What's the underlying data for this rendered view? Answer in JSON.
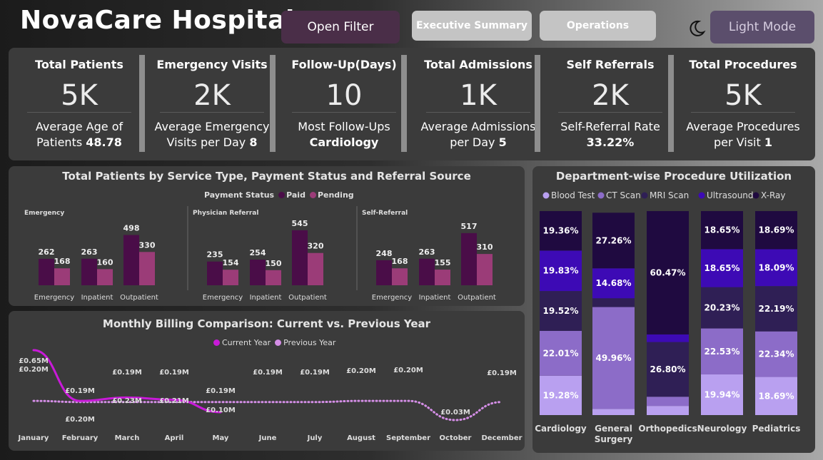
{
  "header": {
    "title": "NovaCare Hospitals",
    "open_filter": "Open Filter",
    "exec_summary": "Executive Summary",
    "operations": "Operations",
    "light_mode": "Light Mode",
    "moon_icon": "moon-icon"
  },
  "kpis": [
    {
      "title": "Total Patients",
      "value": "5K",
      "sub1": "Average Age of",
      "sub2": "Patients",
      "bold": "48.78"
    },
    {
      "title": "Emergency Visits",
      "value": "2K",
      "sub1": "Average Emergency",
      "sub2": "Visits per Day",
      "bold": "8"
    },
    {
      "title": "Follow-Up(Days)",
      "value": "10",
      "sub1": "Most Follow-Ups",
      "sub2": "",
      "bold": "Cardiology"
    },
    {
      "title": "Total Admissions",
      "value": "1K",
      "sub1": "Average Admissions",
      "sub2": "per Day",
      "bold": "5"
    },
    {
      "title": "Self Referrals",
      "value": "2K",
      "sub1": "Self-Referral Rate",
      "sub2": "",
      "bold": "33.22%"
    },
    {
      "title": "Total Procedures",
      "value": "5K",
      "sub1": "Average Procedures",
      "sub2": "per Visit",
      "bold": "1"
    }
  ],
  "colors": {
    "paid": "#4a0d48",
    "pending": "#9b3c78",
    "current_year": "#c81ad8",
    "previous_year": "#d48ee6",
    "blood_test": "#b9a0f0",
    "ct_scan": "#8c6cc8",
    "mri_scan": "#2f1f55",
    "ultrasound": "#3d0ab5",
    "xray": "#1f0a40"
  },
  "chart_data": [
    {
      "type": "bar",
      "title": "Total Patients by Service Type, Payment Status and Referral Source",
      "legend_title": "Payment Status",
      "series_names": [
        "Paid",
        "Pending"
      ],
      "panels": [
        {
          "name": "Emergency",
          "categories": [
            "Emergency",
            "Inpatient",
            "Outpatient"
          ],
          "paid": [
            262,
            263,
            498
          ],
          "pending": [
            168,
            160,
            330
          ]
        },
        {
          "name": "Physician Referral",
          "categories": [
            "Emergency",
            "Inpatient",
            "Outpatient"
          ],
          "paid": [
            235,
            254,
            545
          ],
          "pending": [
            154,
            150,
            320
          ]
        },
        {
          "name": "Self-Referral",
          "categories": [
            "Emergency",
            "Inpatient",
            "Outpatient"
          ],
          "paid": [
            248,
            263,
            517
          ],
          "pending": [
            168,
            155,
            310
          ]
        }
      ]
    },
    {
      "type": "line",
      "title": "Monthly Billing Comparison: Current vs. Previous Year",
      "x": [
        "January",
        "February",
        "March",
        "April",
        "May",
        "June",
        "July",
        "August",
        "September",
        "October",
        "December"
      ],
      "series": [
        {
          "name": "Current Year",
          "values": [
            0.65,
            0.2,
            0.23,
            0.21,
            0.1,
            null,
            null,
            null,
            null,
            null,
            null
          ],
          "labels": [
            "£0.65M",
            "£0.20M",
            "£0.23M",
            "£0.21M",
            "£0.10M",
            "",
            "",
            "",
            "",
            "",
            ""
          ]
        },
        {
          "name": "Previous Year",
          "values": [
            0.2,
            0.19,
            0.19,
            0.19,
            0.19,
            0.19,
            0.19,
            0.2,
            0.2,
            0.03,
            0.19
          ],
          "labels": [
            "£0.20M",
            "£0.19M",
            "£0.19M",
            "£0.19M",
            "£0.19M",
            "£0.19M",
            "£0.19M",
            "£0.20M",
            "£0.20M",
            "£0.03M",
            "£0.19M"
          ]
        }
      ]
    },
    {
      "type": "bar",
      "stacked": "100%",
      "title": "Department-wise Procedure Utilization",
      "legend": [
        "Blood Test",
        "CT Scan",
        "MRI Scan",
        "Ultrasound",
        "X-Ray"
      ],
      "categories": [
        "Cardiology",
        "General Surgery",
        "Orthopedics",
        "Neurology",
        "Pediatrics"
      ],
      "category_lines": [
        [
          "Cardiology"
        ],
        [
          "General",
          "Surgery"
        ],
        [
          "Orthopedics"
        ],
        [
          "Neurology"
        ],
        [
          "Pediatrics"
        ]
      ],
      "series": [
        {
          "name": "Blood Test",
          "values": [
            19.28,
            3.0,
            4.5,
            19.94,
            18.69
          ],
          "labels": [
            "19.28%",
            "",
            "",
            "19.94%",
            "18.69%"
          ]
        },
        {
          "name": "CT Scan",
          "values": [
            22.01,
            49.96,
            4.5,
            22.53,
            22.34
          ],
          "labels": [
            "22.01%",
            "49.96%",
            "",
            "22.53%",
            "22.34%"
          ]
        },
        {
          "name": "MRI Scan",
          "values": [
            19.52,
            4.3,
            26.8,
            20.23,
            22.19
          ],
          "labels": [
            "19.52%",
            "",
            "26.80%",
            "20.23%",
            "22.19%"
          ]
        },
        {
          "name": "Ultrasound",
          "values": [
            19.83,
            14.68,
            3.73,
            18.65,
            18.09
          ],
          "labels": [
            "19.83%",
            "14.68%",
            "",
            "18.65%",
            "18.09%"
          ]
        },
        {
          "name": "X-Ray",
          "values": [
            19.36,
            27.26,
            60.47,
            18.65,
            18.69
          ],
          "labels": [
            "19.36%",
            "27.26%",
            "60.47%",
            "18.65%",
            "18.69%"
          ]
        }
      ]
    }
  ]
}
